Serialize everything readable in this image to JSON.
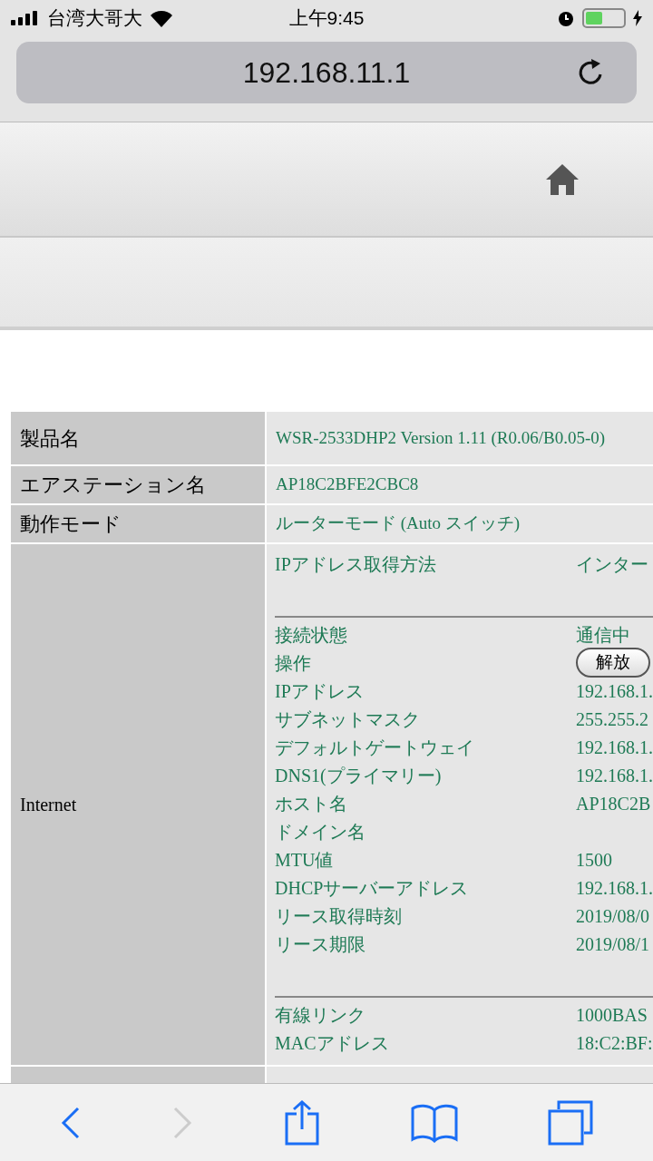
{
  "status_bar": {
    "carrier": "台湾大哥大",
    "time": "上午9:45"
  },
  "address_bar": {
    "url": "192.168.11.1"
  },
  "info_table": {
    "rows": [
      {
        "label": "製品名",
        "value": "WSR-2533DHP2 Version 1.11 (R0.06/B0.05-0)"
      },
      {
        "label": "エアステーション名",
        "value": "AP18C2BFE2CBC8"
      },
      {
        "label": "動作モード",
        "value": "ルーターモード (Auto スイッチ)"
      }
    ],
    "internet": {
      "label": "Internet",
      "sections": [
        [
          {
            "label": "IPアドレス取得方法",
            "value": "インター",
            "kind": "text"
          }
        ],
        [
          {
            "label": "接続状態",
            "value": "通信中",
            "kind": "text"
          },
          {
            "label": "操作",
            "value": "解放",
            "kind": "button"
          },
          {
            "label": "IPアドレス",
            "value": "192.168.1.",
            "kind": "text"
          },
          {
            "label": "サブネットマスク",
            "value": "255.255.2",
            "kind": "text"
          },
          {
            "label": "デフォルトゲートウェイ",
            "value": "192.168.1.",
            "kind": "text"
          },
          {
            "label": "DNS1(プライマリー)",
            "value": "192.168.1.",
            "kind": "text"
          },
          {
            "label": "ホスト名",
            "value": "AP18C2B",
            "kind": "text"
          },
          {
            "label": "ドメイン名",
            "kind": "text"
          },
          {
            "label": "MTU値",
            "value": "1500",
            "kind": "text"
          },
          {
            "label": "DHCPサーバーアドレス",
            "value": "192.168.1.",
            "kind": "text"
          },
          {
            "label": "リース取得時刻",
            "value": "2019/08/0",
            "kind": "text"
          },
          {
            "label": "リース期限",
            "value": "2019/08/1",
            "kind": "text"
          }
        ],
        [
          {
            "label": "有線リンク",
            "value": "1000BAS",
            "kind": "text"
          },
          {
            "label": "MACアドレス",
            "value": "18:C2:BF:",
            "kind": "text"
          }
        ]
      ]
    }
  },
  "toolbar": {
    "back_disabled": false,
    "forward_disabled": true
  }
}
